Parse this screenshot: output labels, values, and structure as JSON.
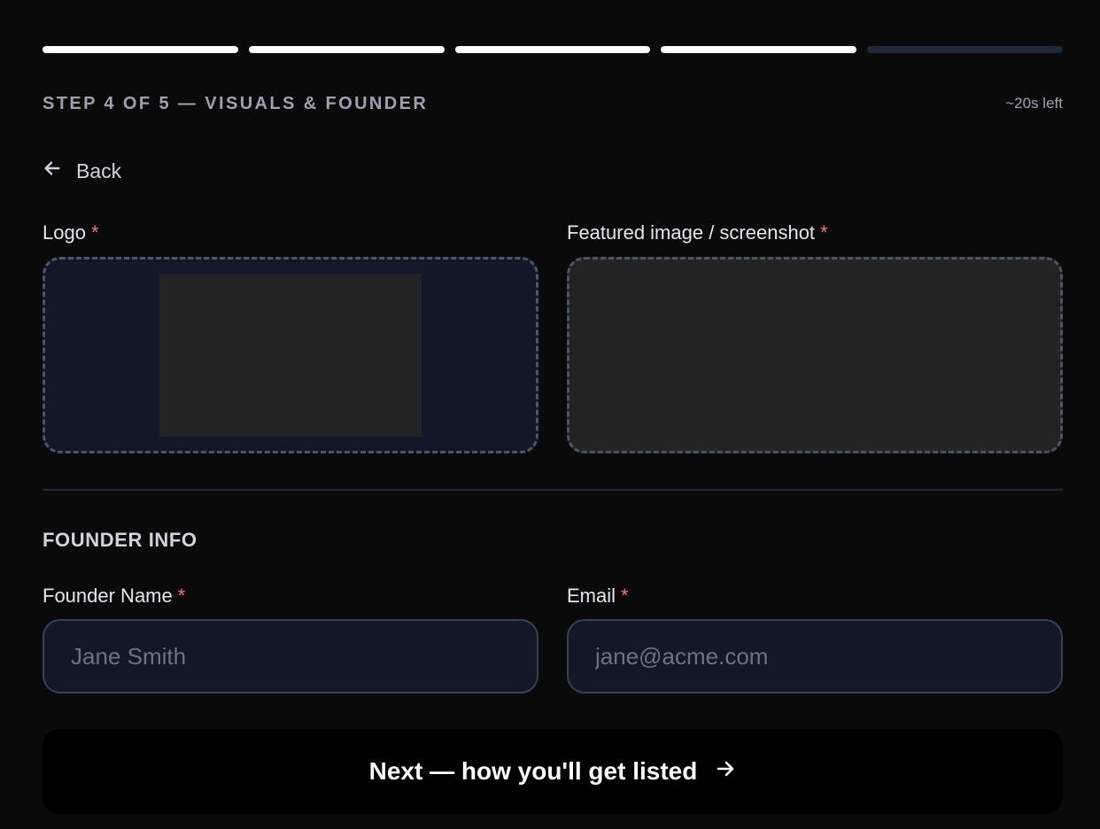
{
  "progress": {
    "total_steps": 5,
    "completed_steps": 4
  },
  "header": {
    "step_label": "STEP 4 OF 5 — VISUALS & FOUNDER",
    "time_left": "~20s left"
  },
  "nav": {
    "back_label": "Back",
    "back_icon": "arrow-left-icon"
  },
  "visuals": {
    "logo_label": "Logo",
    "featured_label": "Featured image / screenshot",
    "required_mark": "*"
  },
  "founder": {
    "section_title": "FOUNDER INFO",
    "name_label": "Founder Name",
    "name_placeholder": "Jane Smith",
    "name_value": "",
    "email_label": "Email",
    "email_placeholder": "jane@acme.com",
    "email_value": ""
  },
  "footer": {
    "next_label": "Next — how you'll get listed",
    "next_icon": "arrow-right-icon"
  },
  "colors": {
    "background": "#0a0a0a",
    "progress_done": "#ffffff",
    "progress_pending": "#1f2937",
    "required": "#f87171"
  }
}
